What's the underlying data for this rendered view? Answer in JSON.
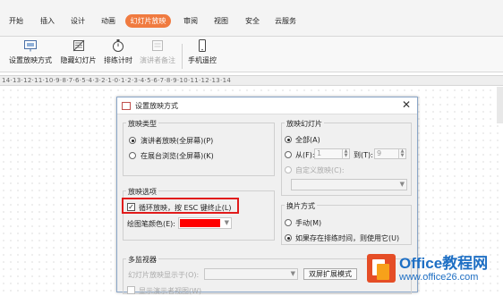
{
  "tabs": [
    "开始",
    "插入",
    "设计",
    "动画",
    "幻灯片放映",
    "审阅",
    "视图",
    "安全",
    "云服务"
  ],
  "ribbon": {
    "setup": "设置放映方式",
    "hide": "隐藏幻灯片",
    "rehearse": "排练计时",
    "notes": "演讲者备注",
    "remote": "手机遥控"
  },
  "ruler_text": "14·13·12·11·10·9·8·7·6·5·4·3·2·1·0·1·2·3·4·5·6·7·8·9·10·11·12·13·14",
  "dialog": {
    "title": "设置放映方式",
    "close": "✕",
    "show_type": {
      "label": "放映类型",
      "opt1": "演讲者放映(全屏幕)(P)",
      "opt2": "在展台浏览(全屏幕)(K)"
    },
    "slides": {
      "label": "放映幻灯片",
      "all": "全部(A)",
      "from": "从(F):",
      "from_val": "1",
      "to": "到(T):",
      "to_val": "9",
      "custom": "自定义放映(C):"
    },
    "options": {
      "label": "放映选项",
      "loop": "循环放映，按 ESC 键终止(L)",
      "pen": "绘图笔颜色(E):",
      "pen_color": "#ff0000"
    },
    "advance": {
      "label": "换片方式",
      "manual": "手动(M)",
      "timing": "如果存在排练时间，则使用它(U)"
    },
    "monitor": {
      "label": "多监视器",
      "display": "幻灯片放映显示于(O):",
      "extend_btn": "双屏扩展模式",
      "presenter": "显示演示者视图(W)"
    }
  },
  "watermark": {
    "line1": "Office教程网",
    "line2": "www.office26.com"
  }
}
